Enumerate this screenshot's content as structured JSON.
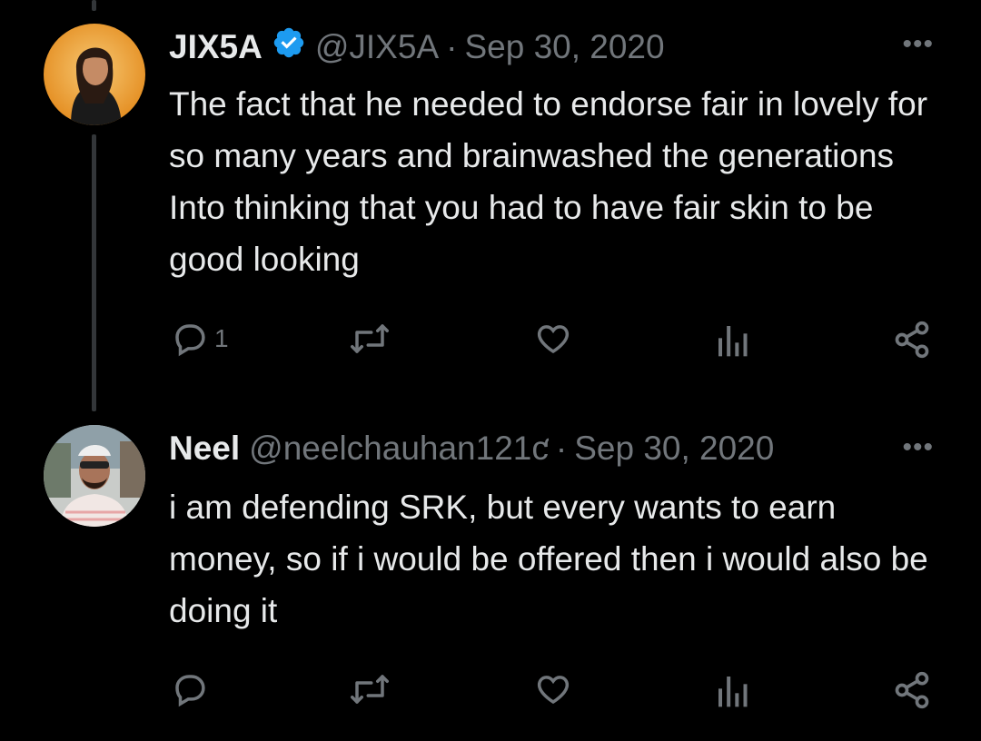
{
  "tweets": [
    {
      "name": "JIX5A",
      "verified": true,
      "handle": "@JIX5A",
      "separator": "·",
      "date": "Sep 30, 2020",
      "more": "•••",
      "text": "The fact that he needed to endorse fair in lovely for so many years and brainwashed the  generations Into thinking that you had to have fair skin to be good looking",
      "actions": {
        "reply_count": "1",
        "retweet_count": "",
        "like_count": "",
        "views_count": ""
      }
    },
    {
      "name": "Neel",
      "verified": false,
      "handle": "@neelchauhan121ƈ",
      "separator": "·",
      "date": "Sep 30, 2020",
      "more": "•••",
      "text": "i am defending SRK, but every wants to earn money, so if i would be offered then i would also be doing it",
      "actions": {
        "reply_count": "",
        "retweet_count": "",
        "like_count": "",
        "views_count": ""
      }
    }
  ],
  "colors": {
    "background": "#000000",
    "text": "#e7e9ea",
    "muted": "#71767b",
    "verified": "#1d9bf0",
    "thread_line": "#333639"
  },
  "icons": [
    "reply-icon",
    "retweet-icon",
    "like-icon",
    "views-icon",
    "share-icon",
    "verified-badge-icon",
    "more-icon"
  ]
}
